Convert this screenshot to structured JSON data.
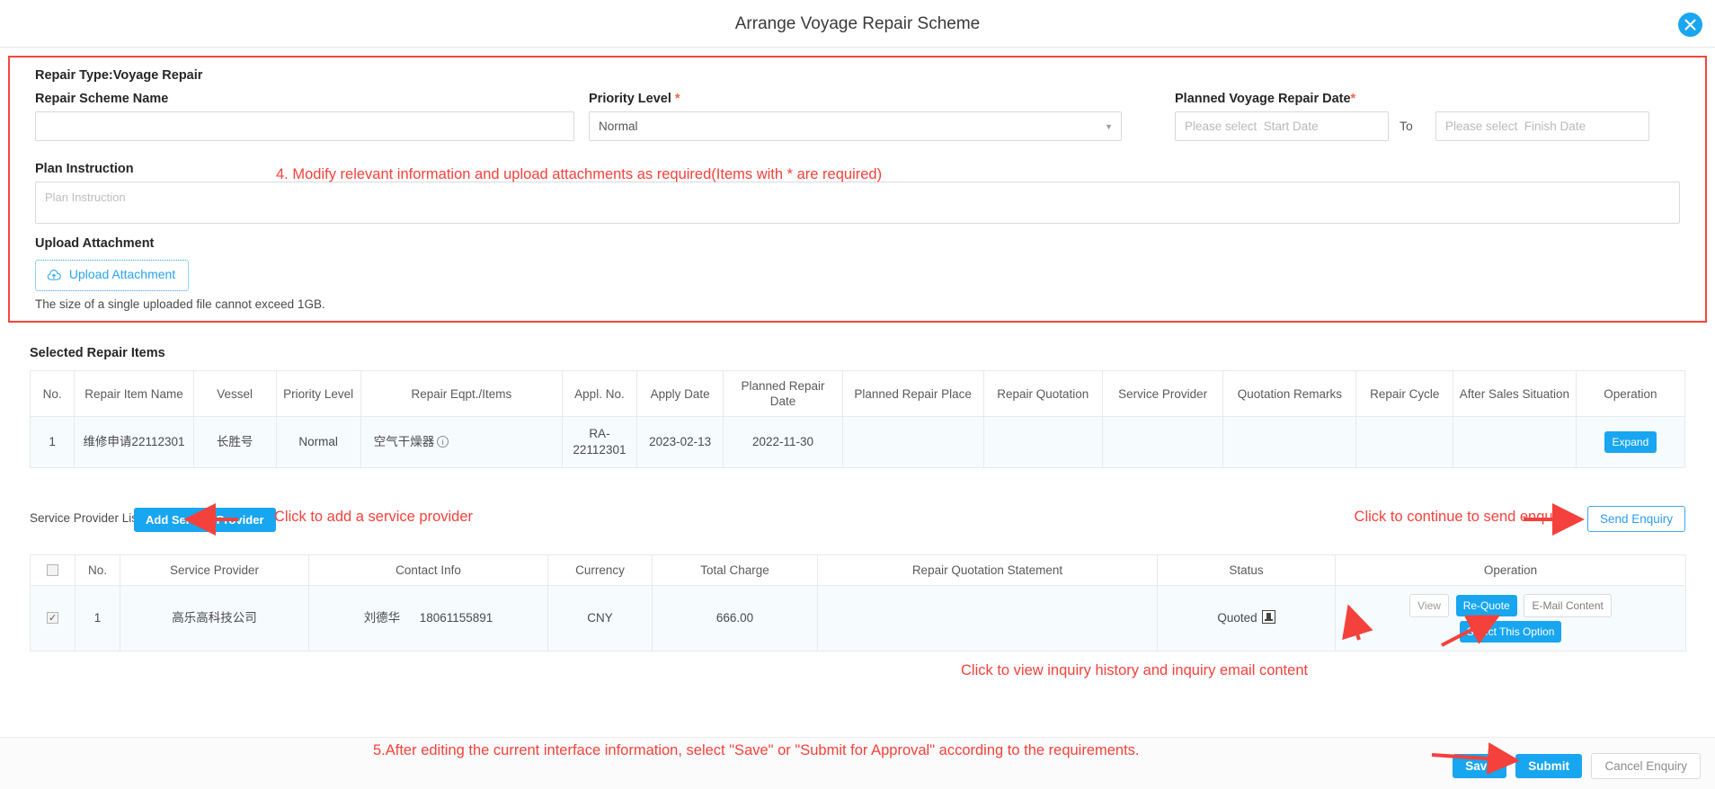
{
  "window": {
    "title": "Arrange Voyage Repair Scheme",
    "close_icon": "close-icon"
  },
  "form": {
    "repair_type": "Repair Type:Voyage Repair",
    "scheme_name_label": "Repair Scheme Name",
    "scheme_name_value": "",
    "scheme_name_placeholder": "",
    "priority_label": "Priority Level",
    "priority_required": "*",
    "priority_value": "Normal",
    "planned_date_label": "Planned Voyage Repair Date",
    "planned_date_required": "*",
    "date_start_placeholder": "Please select  Start Date",
    "date_to": "To",
    "date_finish_placeholder": "Please select  Finish Date",
    "plan_instruction_label": "Plan Instruction",
    "plan_instruction_placeholder": "Plan Instruction",
    "plan_instruction_value": "",
    "upload_label": "Upload Attachment",
    "upload_button": "Upload Attachment",
    "upload_hint": "The size of a single uploaded file cannot exceed 1GB."
  },
  "annotations": {
    "step4": "4. Modify relevant information and upload attachments as required(Items with * are required)",
    "add_provider": "Click to add a service provider",
    "send_enquiry": "Click to continue to send enquiry",
    "inquiry_history": "Click to view inquiry history and inquiry email content",
    "step5": "5.After editing the current interface information, select \"Save\" or \"Submit for Approval\" according to the requirements.",
    "color": "#f5413b"
  },
  "repair_items": {
    "section_title": "Selected Repair Items",
    "columns": [
      "No.",
      "Repair Item Name",
      "Vessel",
      "Priority Level",
      "Repair Eqpt./Items",
      "Appl. No.",
      "Apply Date",
      "Planned Repair Date",
      "Planned Repair Place",
      "Repair Quotation",
      "Service Provider",
      "Quotation Remarks",
      "Repair Cycle",
      "After Sales Situation",
      "Operation"
    ],
    "rows": [
      {
        "no": "1",
        "item_name": "维修申请22112301",
        "vessel": "长胜号",
        "priority": "Normal",
        "eqpt": "空气干燥器",
        "appl_no": "RA-22112301",
        "apply_date": "2023-02-13",
        "planned_repair_date": "2022-11-30",
        "planned_repair_place": "",
        "repair_quotation": "",
        "service_provider": "",
        "quotation_remarks": "",
        "repair_cycle": "",
        "after_sales": "",
        "operation": "Expand"
      }
    ]
  },
  "service_providers": {
    "list_label": "Service Provider List",
    "add_button": "Add Service Provider",
    "send_enquiry_button": "Send Enquiry",
    "columns": [
      "",
      "No.",
      "Service Provider",
      "Contact Info",
      "Currency",
      "Total Charge",
      "Repair Quotation Statement",
      "Status",
      "Operation"
    ],
    "rows": [
      {
        "checked": true,
        "no": "1",
        "provider": "高乐高科技公司",
        "contact_name": "刘德华",
        "contact_phone": "18061155891",
        "currency": "CNY",
        "total_charge": "666.00",
        "statement": "",
        "status": "Quoted",
        "operations": [
          "View",
          "Re-Quote",
          "E-Mail Content",
          "Select This Option"
        ]
      }
    ]
  },
  "footer": {
    "save": "Save",
    "submit": "Submit",
    "cancel_enquiry": "Cancel Enquiry"
  }
}
